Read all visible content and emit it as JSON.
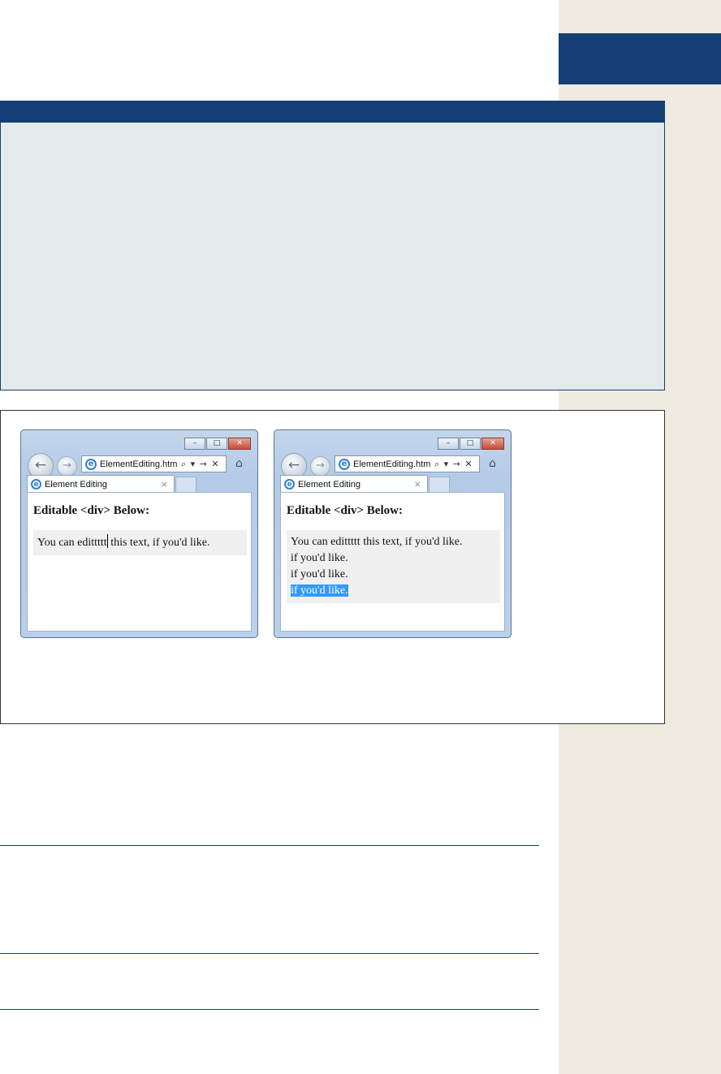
{
  "browser": {
    "address": "ElementEditing.htm",
    "address_tools": "⌕ ▾ → ✕",
    "tab_title": "Element Editing",
    "tab_close": "×",
    "home_icon": "⌂",
    "back_icon": "←",
    "forward_icon": "→",
    "minimize": "–",
    "maximize": "□",
    "close": "✕",
    "ie_icon": "e"
  },
  "left_window": {
    "heading": "Editable <div> Below:",
    "text_before_caret": "You can edittttt",
    "text_after_caret": " this text, if you'd like."
  },
  "right_window": {
    "heading": "Editable <div> Below:",
    "lines": [
      "You can edittttt this text, if you'd like.",
      "if you'd like.",
      "if you'd like."
    ],
    "selected_line": "if you'd like."
  }
}
